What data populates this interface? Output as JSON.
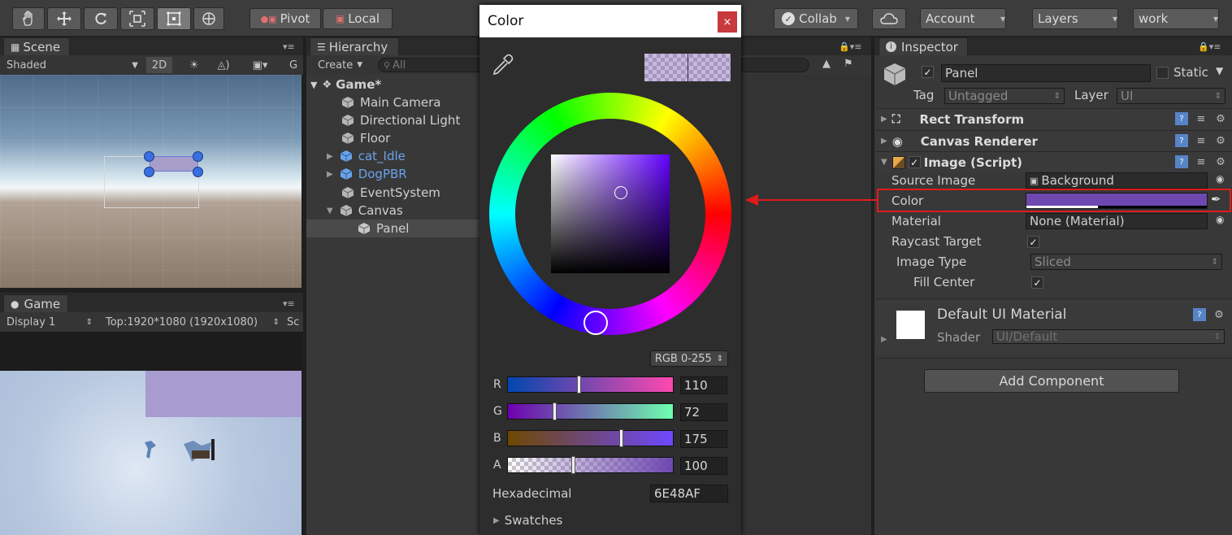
{
  "toolbar": {
    "pivot_label": "Pivot",
    "local_label": "Local",
    "collab_label": "Collab",
    "account_label": "Account",
    "layers_label": "Layers",
    "layout_label": "work"
  },
  "scene": {
    "tab": "Scene",
    "shading_mode": "Shaded",
    "mode_2d": "2D",
    "gizmos_initial": "G"
  },
  "game": {
    "tab": "Game",
    "display": "Display 1",
    "resolution": "Top:1920*1080 (1920x1080)",
    "scale_initial": "Sc"
  },
  "hierarchy": {
    "tab": "Hierarchy",
    "create_label": "Create",
    "search_placeholder": "All",
    "scene_name": "Game*",
    "items": [
      {
        "label": "Main Camera",
        "prefab": false
      },
      {
        "label": "Directional Light",
        "prefab": false
      },
      {
        "label": "Floor",
        "prefab": false
      },
      {
        "label": "cat_Idle",
        "prefab": true
      },
      {
        "label": "DogPBR",
        "prefab": true
      },
      {
        "label": "EventSystem",
        "prefab": false
      },
      {
        "label": "Canvas",
        "prefab": false
      },
      {
        "label": "Panel",
        "prefab": false
      }
    ]
  },
  "color_picker": {
    "title": "Color",
    "close_label": "×",
    "mode": "RGB 0-255",
    "current_color": "#6E48AF",
    "sliders": [
      {
        "label": "R",
        "value": "110",
        "fraction": 0.431
      },
      {
        "label": "G",
        "value": "72",
        "fraction": 0.282
      },
      {
        "label": "B",
        "value": "175",
        "fraction": 0.686
      },
      {
        "label": "A",
        "value": "100",
        "fraction": 0.392
      }
    ],
    "hex_label": "Hexadecimal",
    "hex_value": "6E48AF",
    "swatches_label": "Swatches"
  },
  "inspector": {
    "tab": "Inspector",
    "object_name": "Panel",
    "static_label": "Static",
    "tag_label": "Tag",
    "tag_value": "Untagged",
    "layer_label": "Layer",
    "layer_value": "UI",
    "components": {
      "rect_transform": "Rect Transform",
      "canvas_renderer": "Canvas Renderer",
      "image_script": "Image (Script)"
    },
    "image": {
      "source_image_label": "Source Image",
      "source_image_value": "Background",
      "color_label": "Color",
      "material_label": "Material",
      "material_value": "None (Material)",
      "raycast_label": "Raycast Target",
      "image_type_label": "Image Type",
      "image_type_value": "Sliced",
      "fill_center_label": "Fill Center"
    },
    "material_block": {
      "name": "Default UI Material",
      "shader_label": "Shader",
      "shader_value": "UI/Default"
    },
    "add_component_label": "Add Component"
  },
  "colors": {
    "panel_purple": "#6E48AF",
    "highlight_red": "#e01b1b",
    "prefab_blue": "#6aa3ea"
  }
}
